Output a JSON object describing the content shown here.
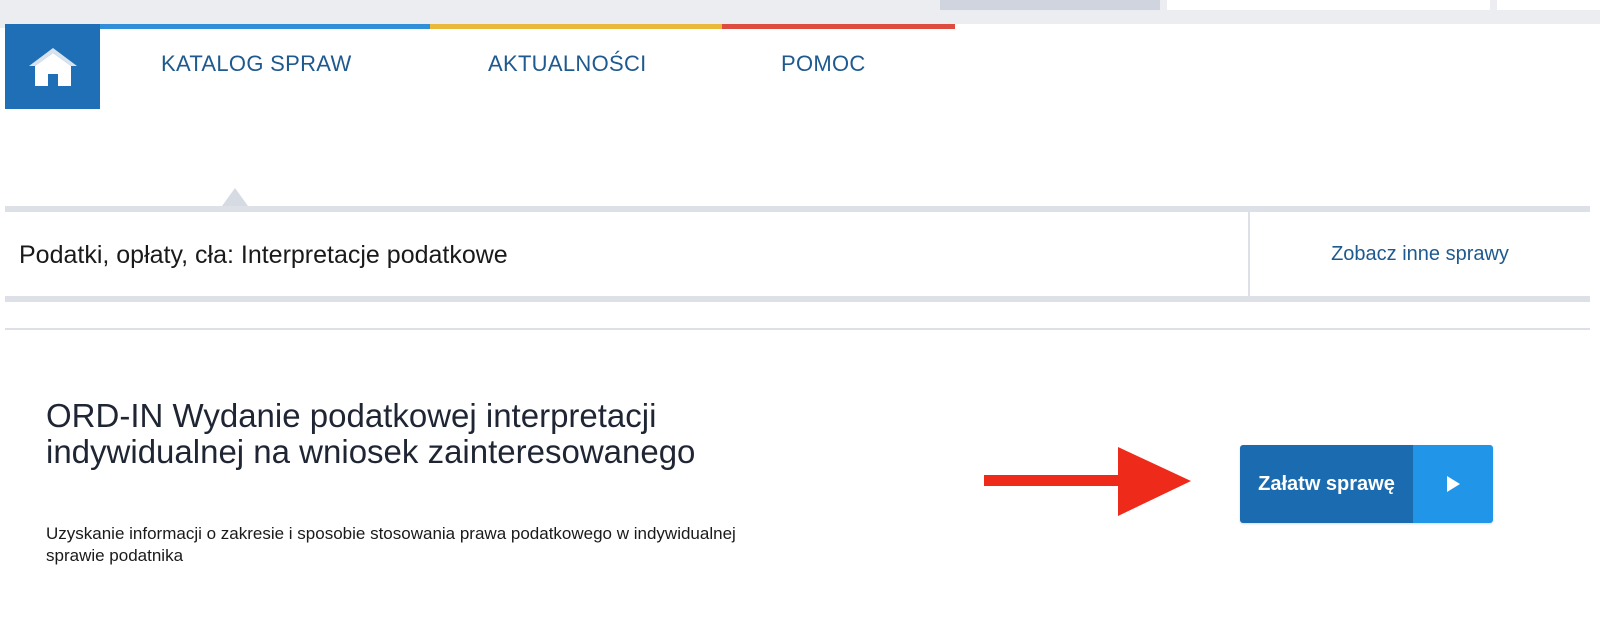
{
  "nav": {
    "home_icon": "home-icon",
    "links": [
      "KATALOG SPRAW",
      "AKTUALNOŚCI",
      "POMOC"
    ],
    "stripe_colors": [
      "#2f8fd8",
      "#e9b93a",
      "#de4b3f"
    ]
  },
  "category": {
    "title": "Podatki, opłaty, cła: Interpretacje podatkowe",
    "see_other": "Zobacz inne sprawy"
  },
  "service": {
    "title": "ORD-IN Wydanie podatkowej interpretacji indywidualnej na wniosek zainteresowanego",
    "description": "Uzyskanie informacji o zakresie i sposobie stosowania prawa podatkowego w indywidualnej sprawie podatnika",
    "action_label": "Załatw sprawę",
    "action_icon": "play-icon"
  },
  "colors": {
    "brand_blue": "#1e6fb5",
    "link_blue": "#1e5a8f",
    "button_dark": "#1a6bb0",
    "button_light": "#2196e8",
    "arrow_red": "#ee2a1b"
  }
}
